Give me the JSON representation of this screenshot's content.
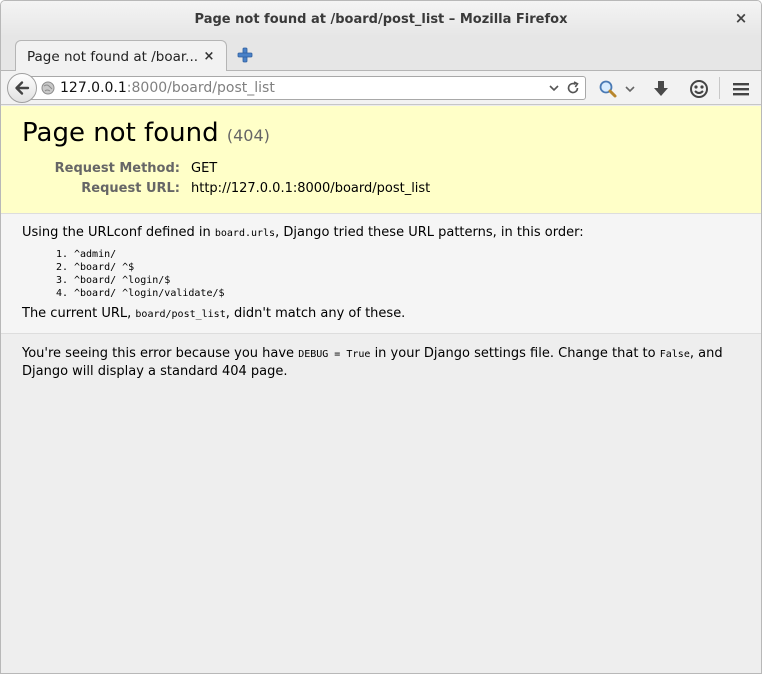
{
  "window": {
    "title": "Page not found at /board/post_list – Mozilla Firefox",
    "close_glyph": "×"
  },
  "tab": {
    "label": "Page not found at /boar...",
    "close_glyph": "×"
  },
  "urlbar": {
    "host": "127.0.0.1",
    "rest": ":8000/board/post_list"
  },
  "icons": {
    "back": "back-arrow-icon",
    "site": "globe-icon",
    "dropdown": "chevron-down-icon",
    "reload": "reload-icon",
    "search": "search-icon",
    "download": "download-icon",
    "social": "smiley-icon",
    "menu": "hamburger-menu-icon",
    "new_tab": "plus-icon"
  },
  "page": {
    "heading": "Page not found",
    "status_code": "(404)",
    "request_method_label": "Request Method:",
    "request_method": "GET",
    "request_url_label": "Request URL:",
    "request_url": "http://127.0.0.1:8000/board/post_list",
    "urlconf_prefix": "Using the URLconf defined in ",
    "urlconf_module": "board.urls",
    "urlconf_suffix": ", Django tried these URL patterns, in this order:",
    "patterns": [
      "^admin/",
      "^board/ ^$",
      "^board/ ^login/$",
      "^board/ ^login/validate/$"
    ],
    "current_prefix": "The current URL, ",
    "current_path": "board/post_list",
    "current_suffix": ", didn't match any of these.",
    "expl_part1": "You're seeing this error because you have ",
    "expl_debug": "DEBUG = True",
    "expl_part2": " in your Django settings file. Change that to ",
    "expl_false": "False",
    "expl_part3": ", and Django will display a standard 404 page."
  },
  "colors": {
    "summary_bg": "#ffffc8",
    "page_bg": "#eeeeee",
    "label_gray": "#666666"
  }
}
